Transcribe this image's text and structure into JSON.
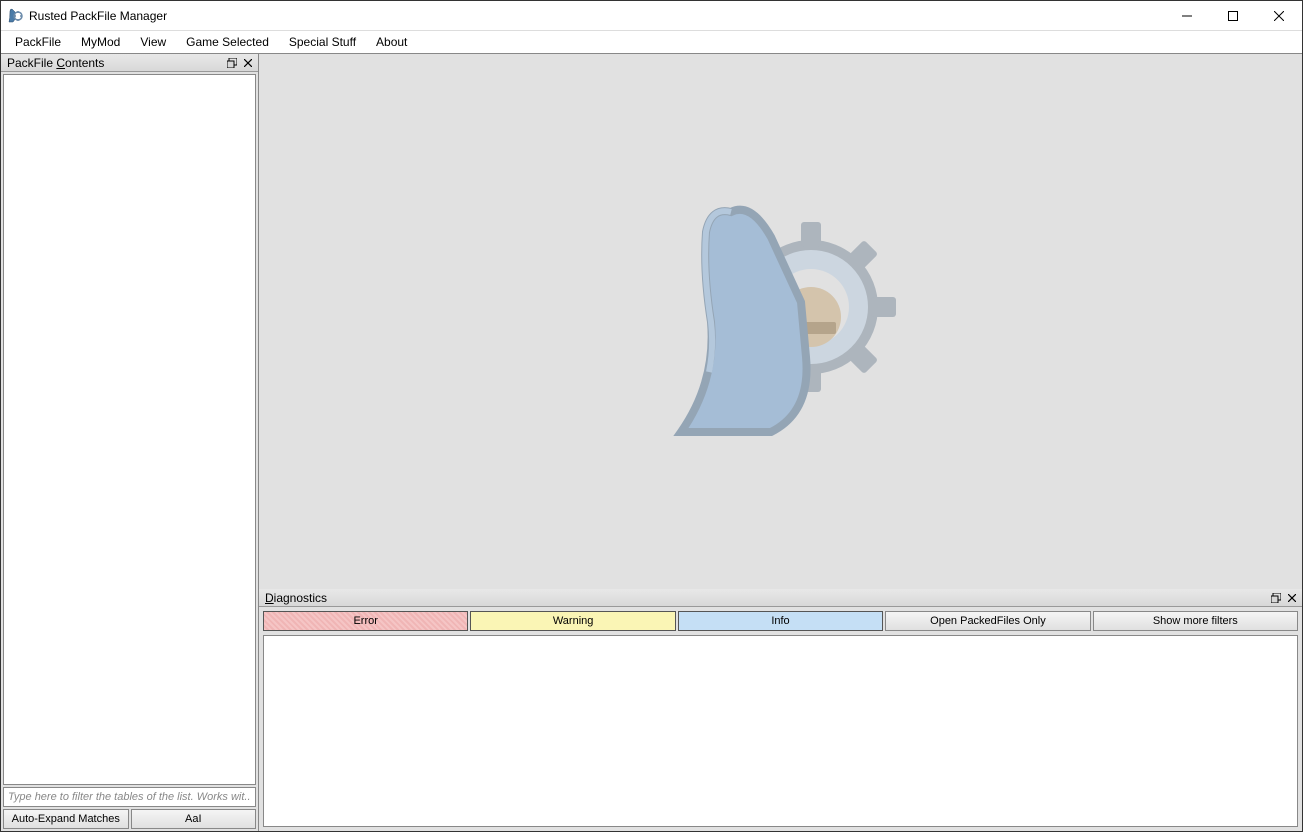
{
  "titlebar": {
    "title": "Rusted PackFile Manager"
  },
  "menubar": {
    "items": [
      "PackFile",
      "MyMod",
      "View",
      "Game Selected",
      "Special Stuff",
      "About"
    ]
  },
  "leftPanel": {
    "title_prefix": "PackFile ",
    "title_underlined": "C",
    "title_suffix": "ontents",
    "filter_placeholder": "Type here to filter the tables of the list. Works wit...",
    "btn_autoexpand": "Auto-Expand Matches",
    "btn_aai": "AaI"
  },
  "diagnostics": {
    "title_underlined": "D",
    "title_suffix": "iagnostics",
    "filters": {
      "error": "Error",
      "warning": "Warning",
      "info": "Info",
      "open_only": "Open PackedFiles Only",
      "show_more": "Show more filters"
    }
  }
}
